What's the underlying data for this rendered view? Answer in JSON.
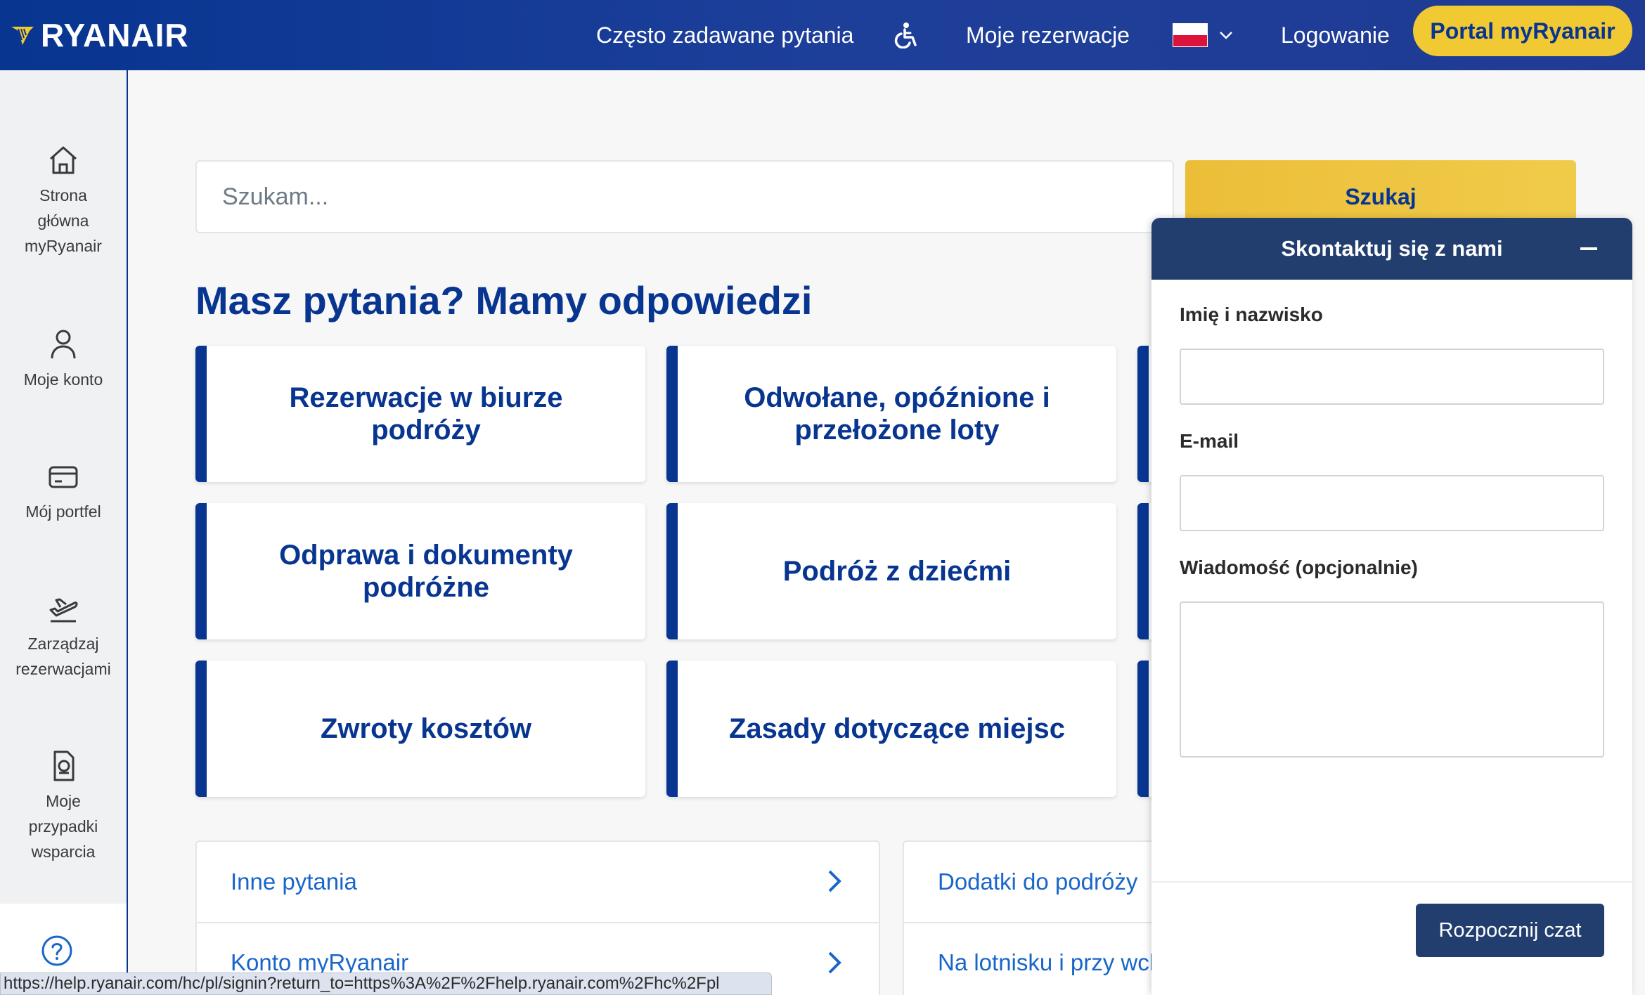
{
  "header": {
    "logo_text": "RYANAIR",
    "faq_label": "Często zadawane pytania",
    "accessibility_icon": "wheelchair-icon",
    "bookings_label": "Moje rezerwacje",
    "language": "pl",
    "login_label": "Logowanie",
    "portal_button": "Portal myRyanair",
    "colors": {
      "brand_blue": "#073590",
      "accent_yellow": "#f1c932"
    }
  },
  "sidebar": {
    "items": [
      {
        "icon": "home-icon",
        "label": "Strona główna myRyanair"
      },
      {
        "icon": "user-icon",
        "label": "Moje konto"
      },
      {
        "icon": "wallet-icon",
        "label": "Mój portfel"
      },
      {
        "icon": "plane-takeoff-icon",
        "label": "Zarządzaj rezerwacjami"
      },
      {
        "icon": "document-icon",
        "label": "Moje przypadki wsparcia"
      }
    ],
    "help_icon": "question-circle-icon"
  },
  "search": {
    "placeholder": "Szukam...",
    "button_label": "Szukaj"
  },
  "main": {
    "title": "Masz pytania? Mamy odpowiedzi",
    "cards": [
      "Rezerwacje w biurze podróży",
      "Odwołane, opóźnione i przełożone loty",
      "",
      "Odprawa i dokumenty podróżne",
      "Podróż z dziećmi",
      "",
      "Zwroty kosztów",
      "Zasady dotyczące miejsc",
      ""
    ],
    "links_left": [
      "Inne pytania",
      "Konto myRyanair"
    ],
    "links_right": [
      "Dodatki do podróży",
      "Na lotnisku i przy wch"
    ]
  },
  "chat": {
    "title": "Skontaktuj się z nami",
    "name_label": "Imię i nazwisko",
    "email_label": "E-mail",
    "message_label": "Wiadomość (opcjonalnie)",
    "start_button": "Rozpocznij czat",
    "header_color": "#223e6e"
  },
  "statusbar": {
    "url": "https://help.ryanair.com/hc/pl/signin?return_to=https%3A%2F%2Fhelp.ryanair.com%2Fhc%2Fpl"
  }
}
